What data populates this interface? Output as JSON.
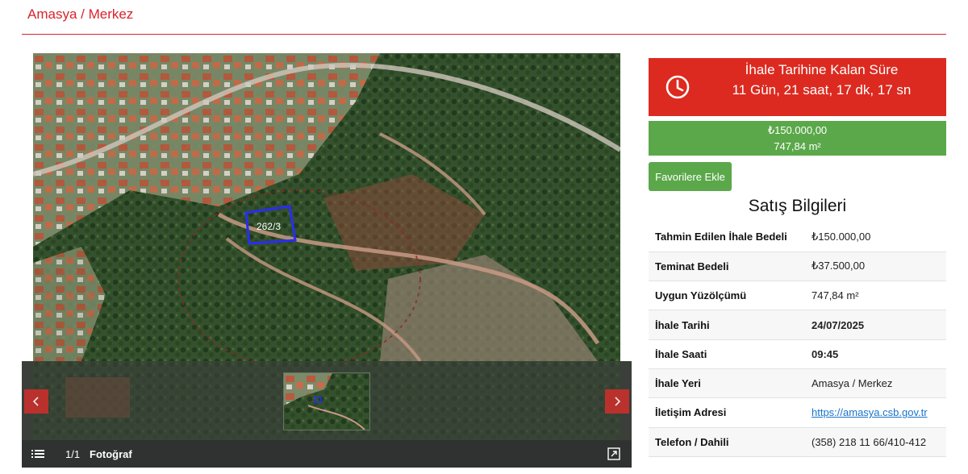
{
  "header": {
    "title": "Amasya / Merkez"
  },
  "gallery": {
    "parcel_label": "262/3",
    "counter": "1/1",
    "photo_label": "Fotoğraf",
    "prev_icon": "chevron-left-icon",
    "next_icon": "chevron-right-icon",
    "menu_icon": "list-icon",
    "expand_icon": "fullscreen-icon"
  },
  "countdown": {
    "icon": "clock-icon",
    "title": "İhale Tarihine Kalan Süre",
    "value": "11 Gün, 21 saat, 17 dk, 17 sn"
  },
  "price_box": {
    "price": "₺150.000,00",
    "area": "747,84 m²"
  },
  "favorite_button": {
    "label": "Favorilere Ekle"
  },
  "sales_info": {
    "title": "Satış Bilgileri",
    "rows": [
      {
        "key": "Tahmin Edilen İhale Bedeli",
        "value": "₺150.000,00"
      },
      {
        "key": "Teminat Bedeli",
        "value": "₺37.500,00"
      },
      {
        "key": "Uygun Yüzölçümü",
        "value": "747,84 m²"
      },
      {
        "key": "İhale Tarihi",
        "value": "24/07/2025"
      },
      {
        "key": "İhale Saati",
        "value": "09:45"
      },
      {
        "key": "İhale Yeri",
        "value": "Amasya / Merkez"
      },
      {
        "key": "İletişim Adresi",
        "value": "https://amasya.csb.gov.tr"
      },
      {
        "key": "Telefon / Dahili",
        "value": "(358) 218 11 66/410-412"
      }
    ]
  },
  "colors": {
    "accent_red": "#dc2a20",
    "accent_green": "#5ba84a",
    "link": "#1a73c8"
  }
}
